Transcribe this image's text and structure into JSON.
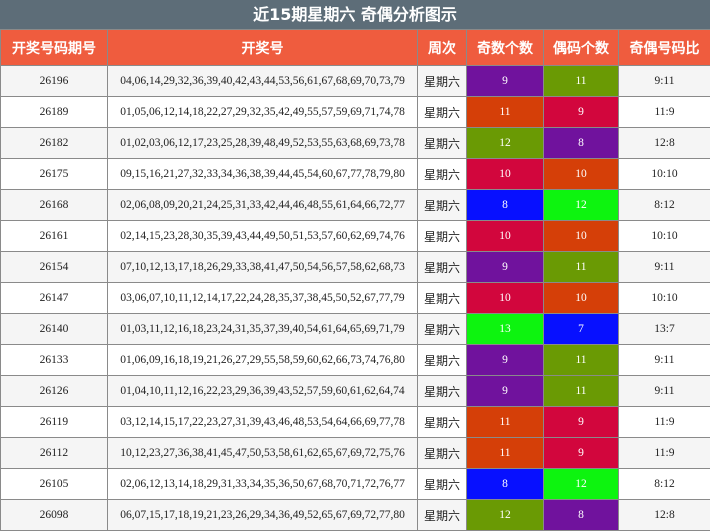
{
  "title": "近15期星期六 奇偶分析图示",
  "headers": [
    "开奖号码期号",
    "开奖号",
    "周次",
    "奇数个数",
    "偶码个数",
    "奇偶号码比"
  ],
  "colors": {
    "purple": "#70129d",
    "green": "#6a9a04",
    "orange": "#d53f08",
    "crimson": "#d2063d",
    "blue": "#0710ff",
    "lime": "#0df40f"
  },
  "rows": [
    {
      "issue": "26196",
      "numbers": "04,06,14,29,32,36,39,40,42,43,44,53,56,61,67,68,69,70,73,79",
      "week": "星期六",
      "odd": "9",
      "even": "11",
      "ratio": "9:11",
      "odd_color": "purple",
      "even_color": "green"
    },
    {
      "issue": "26189",
      "numbers": "01,05,06,12,14,18,22,27,29,32,35,42,49,55,57,59,69,71,74,78",
      "week": "星期六",
      "odd": "11",
      "even": "9",
      "ratio": "11:9",
      "odd_color": "orange",
      "even_color": "crimson"
    },
    {
      "issue": "26182",
      "numbers": "01,02,03,06,12,17,23,25,28,39,48,49,52,53,55,63,68,69,73,78",
      "week": "星期六",
      "odd": "12",
      "even": "8",
      "ratio": "12:8",
      "odd_color": "green",
      "even_color": "purple"
    },
    {
      "issue": "26175",
      "numbers": "09,15,16,21,27,32,33,34,36,38,39,44,45,54,60,67,77,78,79,80",
      "week": "星期六",
      "odd": "10",
      "even": "10",
      "ratio": "10:10",
      "odd_color": "crimson",
      "even_color": "orange"
    },
    {
      "issue": "26168",
      "numbers": "02,06,08,09,20,21,24,25,31,33,42,44,46,48,55,61,64,66,72,77",
      "week": "星期六",
      "odd": "8",
      "even": "12",
      "ratio": "8:12",
      "odd_color": "blue",
      "even_color": "lime"
    },
    {
      "issue": "26161",
      "numbers": "02,14,15,23,28,30,35,39,43,44,49,50,51,53,57,60,62,69,74,76",
      "week": "星期六",
      "odd": "10",
      "even": "10",
      "ratio": "10:10",
      "odd_color": "crimson",
      "even_color": "orange"
    },
    {
      "issue": "26154",
      "numbers": "07,10,12,13,17,18,26,29,33,38,41,47,50,54,56,57,58,62,68,73",
      "week": "星期六",
      "odd": "9",
      "even": "11",
      "ratio": "9:11",
      "odd_color": "purple",
      "even_color": "green"
    },
    {
      "issue": "26147",
      "numbers": "03,06,07,10,11,12,14,17,22,24,28,35,37,38,45,50,52,67,77,79",
      "week": "星期六",
      "odd": "10",
      "even": "10",
      "ratio": "10:10",
      "odd_color": "crimson",
      "even_color": "orange"
    },
    {
      "issue": "26140",
      "numbers": "01,03,11,12,16,18,23,24,31,35,37,39,40,54,61,64,65,69,71,79",
      "week": "星期六",
      "odd": "13",
      "even": "7",
      "ratio": "13:7",
      "odd_color": "lime",
      "even_color": "blue"
    },
    {
      "issue": "26133",
      "numbers": "01,06,09,16,18,19,21,26,27,29,55,58,59,60,62,66,73,74,76,80",
      "week": "星期六",
      "odd": "9",
      "even": "11",
      "ratio": "9:11",
      "odd_color": "purple",
      "even_color": "green"
    },
    {
      "issue": "26126",
      "numbers": "01,04,10,11,12,16,22,23,29,36,39,43,52,57,59,60,61,62,64,74",
      "week": "星期六",
      "odd": "9",
      "even": "11",
      "ratio": "9:11",
      "odd_color": "purple",
      "even_color": "green"
    },
    {
      "issue": "26119",
      "numbers": "03,12,14,15,17,22,23,27,31,39,43,46,48,53,54,64,66,69,77,78",
      "week": "星期六",
      "odd": "11",
      "even": "9",
      "ratio": "11:9",
      "odd_color": "orange",
      "even_color": "crimson"
    },
    {
      "issue": "26112",
      "numbers": "10,12,23,27,36,38,41,45,47,50,53,58,61,62,65,67,69,72,75,76",
      "week": "星期六",
      "odd": "11",
      "even": "9",
      "ratio": "11:9",
      "odd_color": "orange",
      "even_color": "crimson"
    },
    {
      "issue": "26105",
      "numbers": "02,06,12,13,14,18,29,31,33,34,35,36,50,67,68,70,71,72,76,77",
      "week": "星期六",
      "odd": "8",
      "even": "12",
      "ratio": "8:12",
      "odd_color": "blue",
      "even_color": "lime"
    },
    {
      "issue": "26098",
      "numbers": "06,07,15,17,18,19,21,23,26,29,34,36,49,52,65,67,69,72,77,80",
      "week": "星期六",
      "odd": "12",
      "even": "8",
      "ratio": "12:8",
      "odd_color": "green",
      "even_color": "purple"
    }
  ]
}
